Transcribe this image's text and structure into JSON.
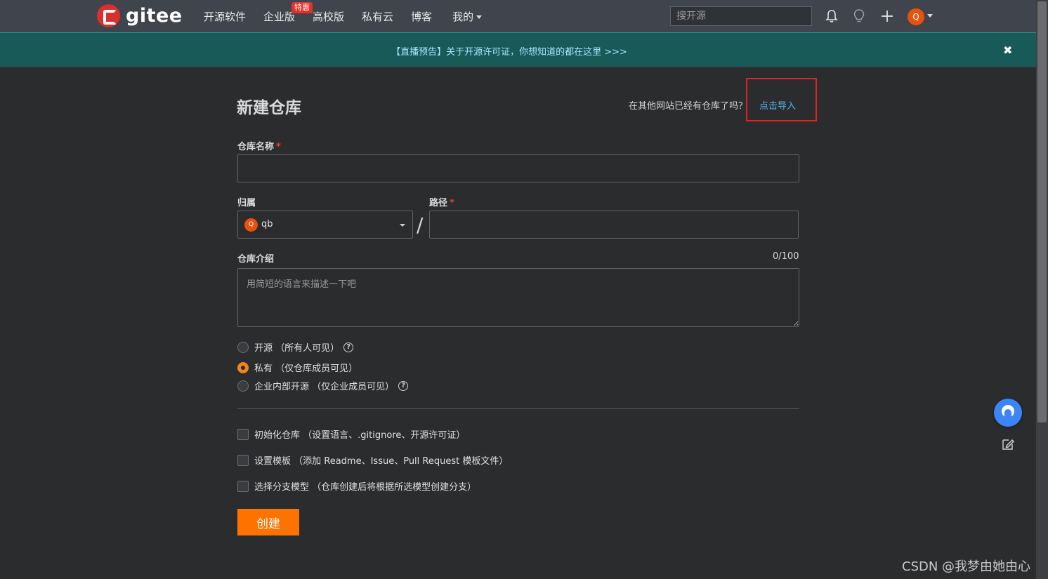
{
  "nav": {
    "logo_text": "gitee",
    "links": [
      "开源软件",
      "企业版",
      "高校版",
      "私有云",
      "博客",
      "我的"
    ],
    "enterprise_badge": "特惠",
    "search_placeholder": "搜开源",
    "user_initial": "Q",
    "icons": [
      "bell-icon",
      "lightbulb-icon",
      "plus-icon"
    ]
  },
  "banner": {
    "text": "【直播预告】关于开源许可证，你想知道的都在这里 >>>",
    "close": "✖"
  },
  "form": {
    "title": "新建仓库",
    "import_hint": "在其他网站已经有仓库了吗？",
    "import_link": "点击导入",
    "repo_name_label": "仓库名称",
    "required_mark": "*",
    "repo_name_value": "",
    "owner_label": "归属",
    "owner_initial": "Q",
    "owner_value": "qb",
    "slash": "/",
    "path_label": "路径",
    "path_value": "",
    "desc_label": "仓库介绍",
    "desc_counter": "0/100",
    "desc_placeholder": "用简短的语言来描述一下吧",
    "visibility": [
      {
        "label": "开源 （所有人可见）",
        "checked": false,
        "help": true
      },
      {
        "label": "私有 （仅仓库成员可见）",
        "checked": true,
        "help": false
      },
      {
        "label": "企业内部开源 （仅企业成员可见）",
        "checked": false,
        "help": true
      }
    ],
    "options": [
      {
        "label": "初始化仓库 （设置语言、.gitignore、开源许可证）",
        "checked": false
      },
      {
        "label": "设置模板 （添加 Readme、Issue、Pull Request 模板文件）",
        "checked": false
      },
      {
        "label": "选择分支模型 （仓库创建后将根据所选模型创建分支）",
        "checked": false
      }
    ],
    "submit_label": "创建"
  },
  "accent_colors": {
    "primary_button": "#fe7300",
    "link": "#5ab4f0",
    "banner_bg": "#175a57",
    "highlight_box": "#e22226"
  },
  "watermark": "CSDN @我梦由她由心"
}
